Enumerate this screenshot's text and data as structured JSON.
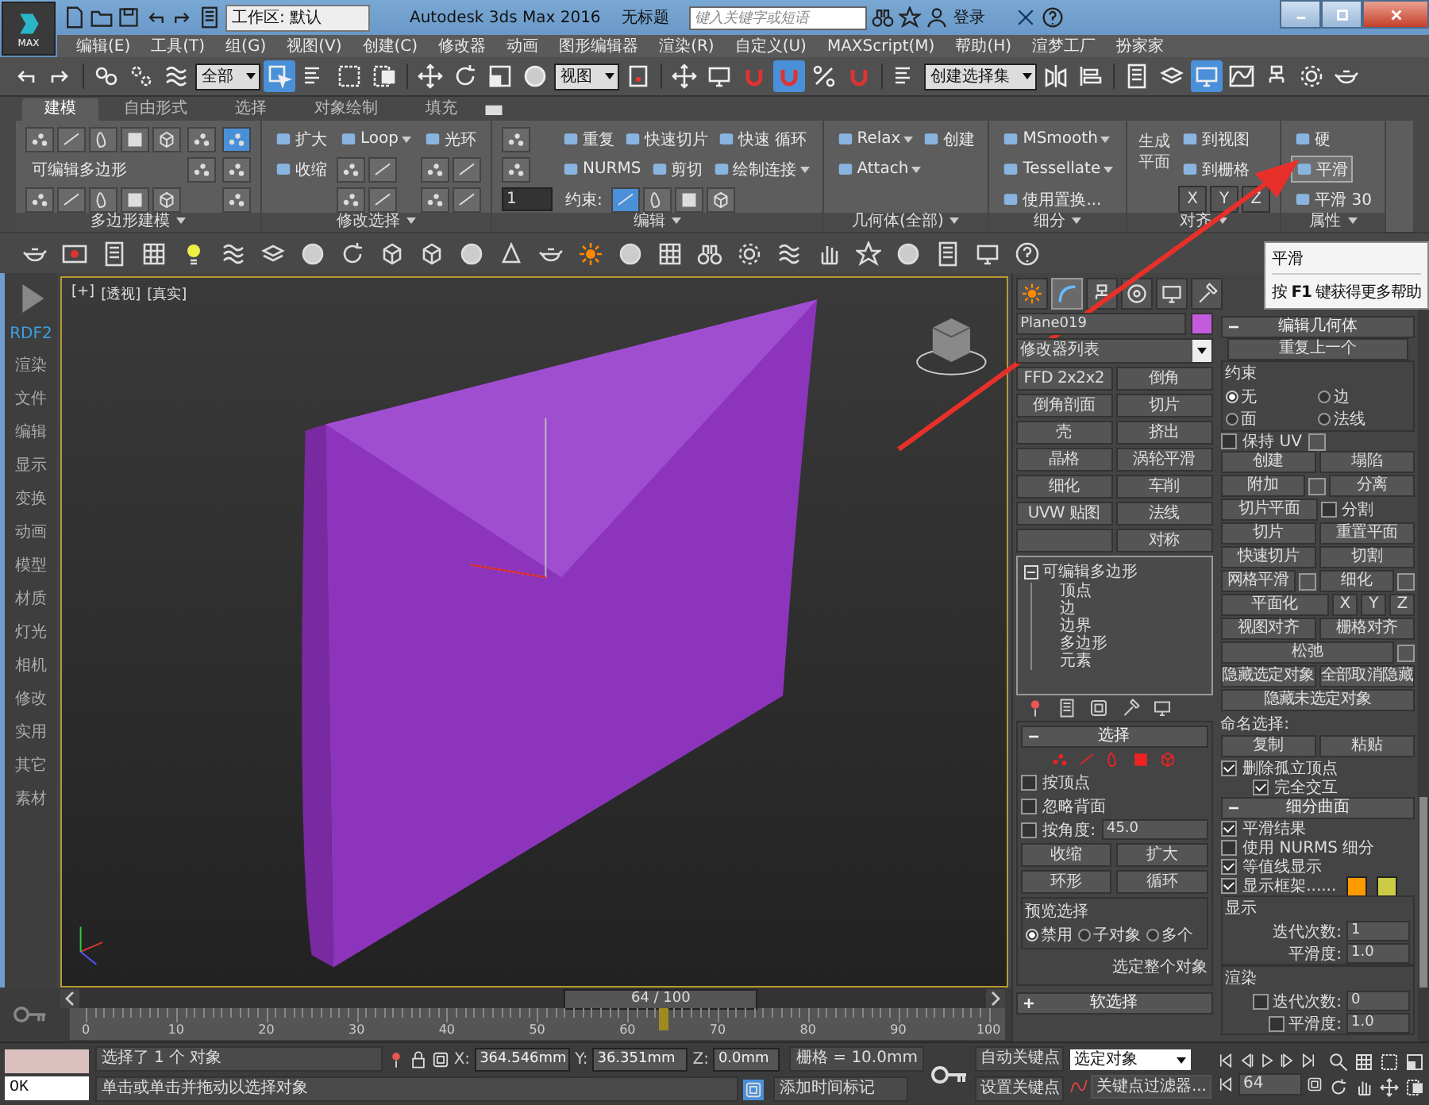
{
  "title_bar": {
    "logo": "MAX",
    "workspace": "工作区: 默认",
    "title": "Autodesk 3ds Max 2016",
    "document": "无标题",
    "search": {
      "placeholder": "键入关键字或短语"
    },
    "login": "登录"
  },
  "menu": [
    "编辑(E)",
    "工具(T)",
    "组(G)",
    "视图(V)",
    "创建(C)",
    "修改器",
    "动画",
    "图形编辑器",
    "渲染(R)",
    "自定义(U)",
    "MAXScript(M)",
    "帮助(H)",
    "渲梦工厂",
    "扮家家"
  ],
  "toolbar": [
    [
      {
        "kind": "undo",
        "on": false
      },
      {
        "kind": "redo",
        "on": false
      }
    ],
    [
      {
        "kind": "link",
        "on": false
      },
      {
        "kind": "unlink",
        "on": false
      },
      {
        "kind": "wave",
        "on": false
      },
      {
        "kind": "dropdown",
        "value": "全部",
        "on": false
      },
      {
        "kind": "select",
        "on": true
      },
      {
        "kind": "list",
        "on": false
      },
      {
        "kind": "rect",
        "on": false
      },
      {
        "kind": "window",
        "on": false
      }
    ],
    [
      {
        "kind": "move",
        "on": false
      },
      {
        "kind": "rotate",
        "on": false
      },
      {
        "kind": "scale",
        "on": false
      },
      {
        "kind": "sphere",
        "on": false
      },
      {
        "kind": "dropdown",
        "value": "视图",
        "on": false
      },
      {
        "kind": "pivot",
        "on": false
      }
    ],
    [
      {
        "kind": "move",
        "on": false
      },
      {
        "kind": "display",
        "on": false
      },
      {
        "kind": "magnet",
        "on": false
      },
      {
        "kind": "magnet",
        "on": true
      },
      {
        "kind": "percent",
        "on": false
      },
      {
        "kind": "magnet",
        "on": false
      }
    ],
    [
      {
        "kind": "list",
        "on": false
      },
      {
        "kind": "dropdown",
        "value": "创建选择集",
        "on": false
      },
      {
        "kind": "mirror",
        "on": false
      },
      {
        "kind": "align",
        "on": false
      }
    ],
    [
      {
        "kind": "page",
        "on": false
      },
      {
        "kind": "layers",
        "on": false
      },
      {
        "kind": "display",
        "on": true
      },
      {
        "kind": "graph",
        "on": false
      },
      {
        "kind": "hierarchy",
        "on": false
      },
      {
        "kind": "gear",
        "on": false
      },
      {
        "kind": "teapot",
        "on": false
      }
    ]
  ],
  "ribbon": {
    "tabs": [
      {
        "label": "建模",
        "selected": true
      },
      {
        "label": "自由形式",
        "selected": false
      },
      {
        "label": "选择",
        "selected": false
      },
      {
        "label": "对象绘制",
        "selected": false
      },
      {
        "label": "填充",
        "selected": false
      }
    ],
    "groups": [
      {
        "label": "多边形建模",
        "cols": [
          [
            [
              {
                "kind": "icon",
                "on": false
              },
              {
                "kind": "icon",
                "on": false
              },
              {
                "kind": "icon",
                "on": false
              },
              {
                "kind": "icon",
                "on": false
              },
              {
                "kind": "icon",
                "on": false
              }
            ],
            [
              {
                "kind": "text",
                "text": "可编辑多边形"
              }
            ],
            [
              {
                "kind": "icon",
                "on": false
              },
              {
                "kind": "icon",
                "on": false
              },
              {
                "kind": "icon",
                "on": false
              },
              {
                "kind": "icon",
                "on": false
              },
              {
                "kind": "icon",
                "on": false
              }
            ]
          ],
          [
            [
              {
                "kind": "icon",
                "on": false
              }
            ],
            [
              {
                "kind": "icon",
                "on": false
              }
            ]
          ],
          [
            [
              {
                "kind": "icon",
                "on": true
              }
            ],
            [
              {
                "kind": "icon",
                "on": false
              }
            ],
            [
              {
                "kind": "icon",
                "on": false
              }
            ]
          ]
        ]
      },
      {
        "label": "修改选择",
        "cols": [
          [
            [
              {
                "kind": "tool",
                "text": "扩大",
                "on": false,
                "dropdown": false
              }
            ],
            [
              {
                "kind": "tool",
                "text": "收缩",
                "on": false,
                "dropdown": false
              }
            ]
          ],
          [
            [
              {
                "kind": "tool",
                "text": "Loop",
                "on": false,
                "dropdown": true
              }
            ],
            [
              {
                "kind": "icon",
                "on": false
              },
              {
                "kind": "icon",
                "on": false
              }
            ],
            [
              {
                "kind": "icon",
                "on": false
              },
              {
                "kind": "icon",
                "on": false
              }
            ]
          ],
          [
            [
              {
                "kind": "tool",
                "text": "光环",
                "on": false,
                "dropdown": false
              }
            ],
            [
              {
                "kind": "icon",
                "on": false
              },
              {
                "kind": "icon",
                "on": false
              }
            ],
            [
              {
                "kind": "icon",
                "on": false
              },
              {
                "kind": "icon",
                "on": false
              }
            ]
          ]
        ]
      },
      {
        "label": "编辑",
        "cols": [
          [
            [
              {
                "kind": "icon",
                "on": false
              }
            ],
            [
              {
                "kind": "icon",
                "on": false
              }
            ],
            [
              {
                "kind": "spin",
                "text": "1"
              }
            ]
          ],
          [
            [
              {
                "kind": "tool",
                "text": "重复",
                "on": false,
                "dropdown": false
              },
              {
                "kind": "tool",
                "text": "快速切片",
                "on": false,
                "dropdown": false
              },
              {
                "kind": "tool",
                "text": "快速 循环",
                "on": false,
                "dropdown": false
              }
            ],
            [
              {
                "kind": "tool",
                "text": "NURMS",
                "on": false,
                "dropdown": false
              },
              {
                "kind": "tool",
                "text": "剪切",
                "on": false,
                "dropdown": false
              },
              {
                "kind": "tool",
                "text": "绘制连接",
                "on": false,
                "dropdown": true
              }
            ],
            [
              {
                "kind": "text",
                "text": "约束:"
              },
              {
                "kind": "icon",
                "on": true
              },
              {
                "kind": "icon",
                "on": false
              },
              {
                "kind": "icon",
                "on": false
              },
              {
                "kind": "icon",
                "on": false
              }
            ]
          ]
        ]
      },
      {
        "label": "几何体(全部)",
        "cols": [
          [
            [
              {
                "kind": "tool",
                "text": "Relax",
                "on": false,
                "dropdown": true
              },
              {
                "kind": "tool",
                "text": "创建",
                "on": false,
                "dropdown": false
              }
            ],
            [
              {
                "kind": "tool",
                "text": "Attach",
                "on": false,
                "dropdown": true
              }
            ]
          ]
        ]
      },
      {
        "label": "细分",
        "cols": [
          [
            [
              {
                "kind": "tool",
                "text": "MSmooth",
                "on": false,
                "dropdown": true
              }
            ],
            [
              {
                "kind": "tool",
                "text": "Tessellate",
                "on": false,
                "dropdown": true
              }
            ],
            [
              {
                "kind": "tool",
                "text": "使用置换...",
                "on": false,
                "dropdown": false
              }
            ]
          ]
        ]
      },
      {
        "label": "对齐",
        "cols": [
          [
            [
              {
                "kind": "big",
                "text": "生成平面"
              }
            ]
          ],
          [
            [
              {
                "kind": "tool",
                "text": "到视图",
                "on": false,
                "dropdown": false
              }
            ],
            [
              {
                "kind": "tool",
                "text": "到栅格",
                "on": false,
                "dropdown": false
              }
            ],
            [
              {
                "kind": "key",
                "text": "X"
              },
              {
                "kind": "key",
                "text": "Y"
              },
              {
                "kind": "key",
                "text": "Z"
              }
            ]
          ]
        ]
      },
      {
        "label": "属性",
        "cols": [
          [
            [
              {
                "kind": "tool",
                "text": "硬",
                "on": false,
                "dropdown": false
              }
            ],
            [
              {
                "kind": "tool",
                "text": "平滑",
                "on": true,
                "dropdown": false
              }
            ],
            [
              {
                "kind": "tool",
                "text": "平滑 30",
                "on": false,
                "dropdown": false
              }
            ]
          ]
        ]
      }
    ]
  },
  "sidebar": [
    {
      "label": "RDF2",
      "selected": true
    },
    {
      "label": "渲染",
      "selected": false
    },
    {
      "label": "文件",
      "selected": false
    },
    {
      "label": "编辑",
      "selected": false
    },
    {
      "label": "显示",
      "selected": false
    },
    {
      "label": "变换",
      "selected": false
    },
    {
      "label": "动画",
      "selected": false
    },
    {
      "label": "模型",
      "selected": false
    },
    {
      "label": "材质",
      "selected": false
    },
    {
      "label": "灯光",
      "selected": false
    },
    {
      "label": "相机",
      "selected": false
    },
    {
      "label": "修改",
      "selected": false
    },
    {
      "label": "实用",
      "selected": false
    },
    {
      "label": "其它",
      "selected": false
    },
    {
      "label": "素材",
      "selected": false
    }
  ],
  "viewport": {
    "labels": [
      "[+]",
      "[透视]",
      "[真实]"
    ]
  },
  "timeline": {
    "frame": "64 / 100",
    "level": 0.64,
    "ruler": [
      "0",
      "10",
      "20",
      "30",
      "40",
      "50",
      "60",
      "70",
      "80",
      "90",
      "100"
    ]
  },
  "command_panel": {
    "tabs": [
      {
        "kind": "create",
        "selected": false
      },
      {
        "kind": "modify",
        "selected": true
      },
      {
        "kind": "hierarchy",
        "selected": false
      },
      {
        "kind": "motion",
        "selected": false
      },
      {
        "kind": "display",
        "selected": false
      },
      {
        "kind": "utilities",
        "selected": false
      }
    ],
    "object_name": "Plane019",
    "modifier_list": "修改器列表",
    "modifiers": [
      {
        "kind": "button",
        "label": "FFD 2x2x2"
      },
      {
        "kind": "button",
        "label": "倒角"
      },
      {
        "kind": "button",
        "label": "倒角剖面"
      },
      {
        "kind": "button",
        "label": "切片"
      },
      {
        "kind": "button",
        "label": "壳"
      },
      {
        "kind": "button",
        "label": "挤出"
      },
      {
        "kind": "button",
        "label": "晶格"
      },
      {
        "kind": "button",
        "label": "涡轮平滑"
      },
      {
        "kind": "button",
        "label": "细化"
      },
      {
        "kind": "button",
        "label": "车削"
      },
      {
        "kind": "button",
        "label": "UVW 贴图"
      },
      {
        "kind": "button",
        "label": "法线"
      },
      {
        "kind": "blank"
      },
      {
        "kind": "button",
        "label": "对称"
      }
    ],
    "stack": {
      "label": "可编辑多边形",
      "expanded": true,
      "children": [
        "顶点",
        "边",
        "边界",
        "多边形",
        "元素"
      ]
    },
    "selection": {
      "title": "选择",
      "checks": [
        {
          "label": "按顶点",
          "checked": false
        },
        {
          "label": "忽略背面",
          "checked": false
        },
        {
          "label": "按角度:",
          "checked": false
        }
      ],
      "angle": "45.0",
      "buttons": [
        "收缩",
        "扩大"
      ],
      "spinners": [
        "环形",
        "循环"
      ],
      "preview": {
        "title": "预览选择",
        "options": [
          {
            "label": "禁用",
            "selected": true
          },
          {
            "label": "子对象",
            "selected": false
          },
          {
            "label": "多个",
            "selected": false
          }
        ]
      },
      "status": "选定整个对象"
    },
    "soft_selection": {
      "title": "软选择",
      "expanded": false
    }
  },
  "edit_geometry": {
    "title": "编辑几何体",
    "repeat": "重复上一个",
    "constraints": {
      "title": "约束",
      "options": [
        {
          "label": "无",
          "selected": true
        },
        {
          "label": "边",
          "selected": false
        },
        {
          "label": "面",
          "selected": false
        },
        {
          "label": "法线",
          "selected": false
        }
      ]
    },
    "keep_uv": {
      "label": "保持 UV",
      "checked": false
    },
    "rows": [
      [
        {
          "kind": "button",
          "label": "创建"
        },
        {
          "kind": "button",
          "label": "塌陷"
        }
      ],
      [
        {
          "kind": "settings",
          "label": "附加"
        },
        {
          "kind": "button",
          "label": "分离"
        }
      ],
      [
        {
          "kind": "button",
          "label": "切片平面"
        },
        {
          "kind": "check",
          "label": "分割",
          "checked": false
        }
      ],
      [
        {
          "kind": "button",
          "label": "切片"
        },
        {
          "kind": "button",
          "label": "重置平面"
        }
      ],
      [
        {
          "kind": "button",
          "label": "快速切片"
        },
        {
          "kind": "button",
          "label": "切割"
        }
      ],
      [
        {
          "kind": "settings",
          "label": "网格平滑"
        },
        {
          "kind": "settings",
          "label": "细化"
        }
      ],
      [
        {
          "kind": "button",
          "label": "平面化"
        },
        {
          "kind": "small",
          "label": "X"
        },
        {
          "kind": "small",
          "label": "Y"
        },
        {
          "kind": "small",
          "label": "Z"
        }
      ],
      [
        {
          "kind": "button",
          "label": "视图对齐"
        },
        {
          "kind": "button",
          "label": "栅格对齐"
        }
      ],
      [
        {
          "kind": "settings",
          "label": "松弛"
        }
      ],
      [
        {
          "kind": "button",
          "label": "隐藏选定对象"
        },
        {
          "kind": "button",
          "label": "全部取消隐藏"
        }
      ],
      [
        {
          "kind": "button",
          "label": "隐藏未选定对象"
        }
      ]
    ],
    "named": "命名选择:",
    "named_buttons": [
      "复制",
      "粘贴"
    ],
    "checks": [
      {
        "label": "删除孤立顶点",
        "checked": true
      },
      {
        "label": "完全交互",
        "checked": true
      }
    ]
  },
  "subdivision": {
    "title": "细分曲面",
    "checks": [
      {
        "label": "平滑结果",
        "checked": true
      },
      {
        "label": "使用 NURMS 细分",
        "checked": false
      },
      {
        "label": "等值线显示",
        "checked": true
      },
      {
        "label": "显示框架......",
        "checked": true
      }
    ],
    "frame_colors": [
      {
        "color": "#ff9900"
      },
      {
        "color": "#cccc44"
      }
    ],
    "display": {
      "title": "显示",
      "fields": [
        {
          "label": "迭代次数:",
          "value": "1"
        },
        {
          "label": "平滑度:",
          "value": "1.0"
        }
      ]
    },
    "render": {
      "title": "渲染",
      "fields": [
        {
          "label": "迭代次数:",
          "value": "0",
          "checked": false
        },
        {
          "label": "平滑度:",
          "value": "1.0",
          "checked": false
        }
      ]
    }
  },
  "tooltip": {
    "title": "平滑",
    "hint": "按 **F1** 键获得更多帮助"
  },
  "status_bar": {
    "listener": "OK",
    "selected": "选择了 1 个 对象",
    "prompt": "单击或单击并拖动以选择对象",
    "coordinates": [
      {
        "label": "X:",
        "value": "364.546mm"
      },
      {
        "label": "Y:",
        "value": "36.351mm"
      },
      {
        "label": "Z:",
        "value": "0.0mm"
      }
    ],
    "grid": "栅格 = 10.0mm",
    "time_tag": "添加时间标记",
    "auto_key": "自动关键点",
    "set_key": "设置关键点",
    "key_mode": "选定对象",
    "key_filters": "关键点过滤器...",
    "frame": "64"
  }
}
